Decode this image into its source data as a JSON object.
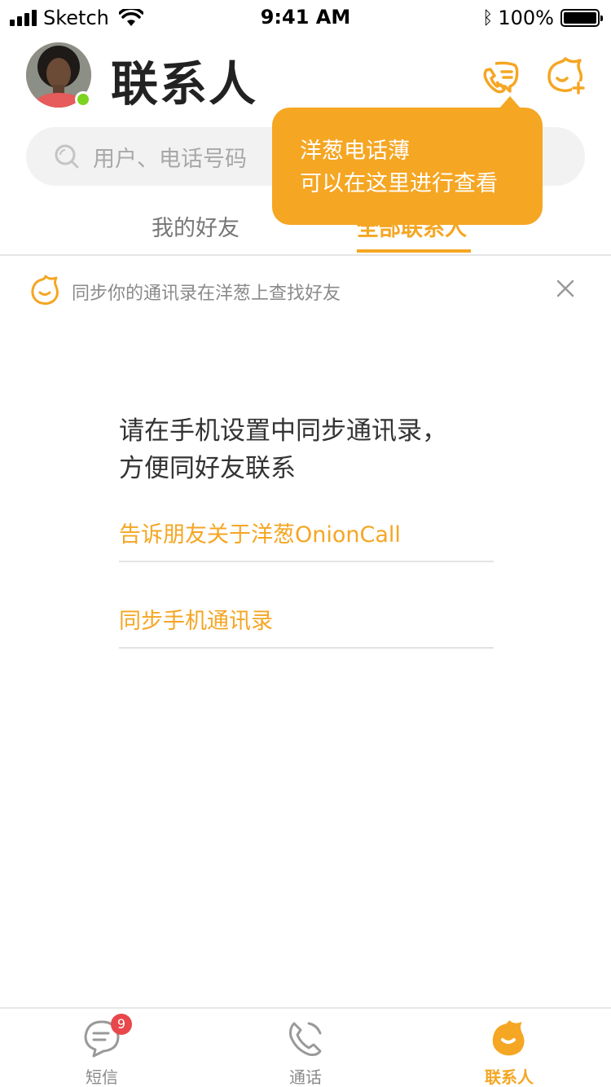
{
  "status_bar": {
    "carrier": "Sketch",
    "time": "9:41 AM",
    "battery": "100%"
  },
  "header": {
    "title": "联系人"
  },
  "search": {
    "placeholder": "用户、电话号码"
  },
  "tooltip": {
    "line1": "洋葱电话薄",
    "line2": "可以在这里进行查看"
  },
  "tabs": [
    {
      "label": "我的好友",
      "active": false
    },
    {
      "label": "全部联系人",
      "active": true
    }
  ],
  "sync_banner": {
    "text": "同步你的通讯录在洋葱上查找好友"
  },
  "empty_state": {
    "message_line1": "请在手机设置中同步通讯录，",
    "message_line2": "方便同好友联系",
    "link_tell_friends": "告诉朋友关于洋葱OnionCall",
    "link_sync_contacts": "同步手机通讯录"
  },
  "bottom_nav": {
    "items": [
      {
        "label": "短信",
        "icon": "message-icon",
        "badge": "9",
        "active": false
      },
      {
        "label": "通话",
        "icon": "phone-icon",
        "active": false
      },
      {
        "label": "联系人",
        "icon": "onion-icon",
        "active": true
      }
    ]
  },
  "colors": {
    "accent": "#f5a623",
    "badge": "#e8474c",
    "online": "#7ed321",
    "muted": "#8a8a8a"
  }
}
